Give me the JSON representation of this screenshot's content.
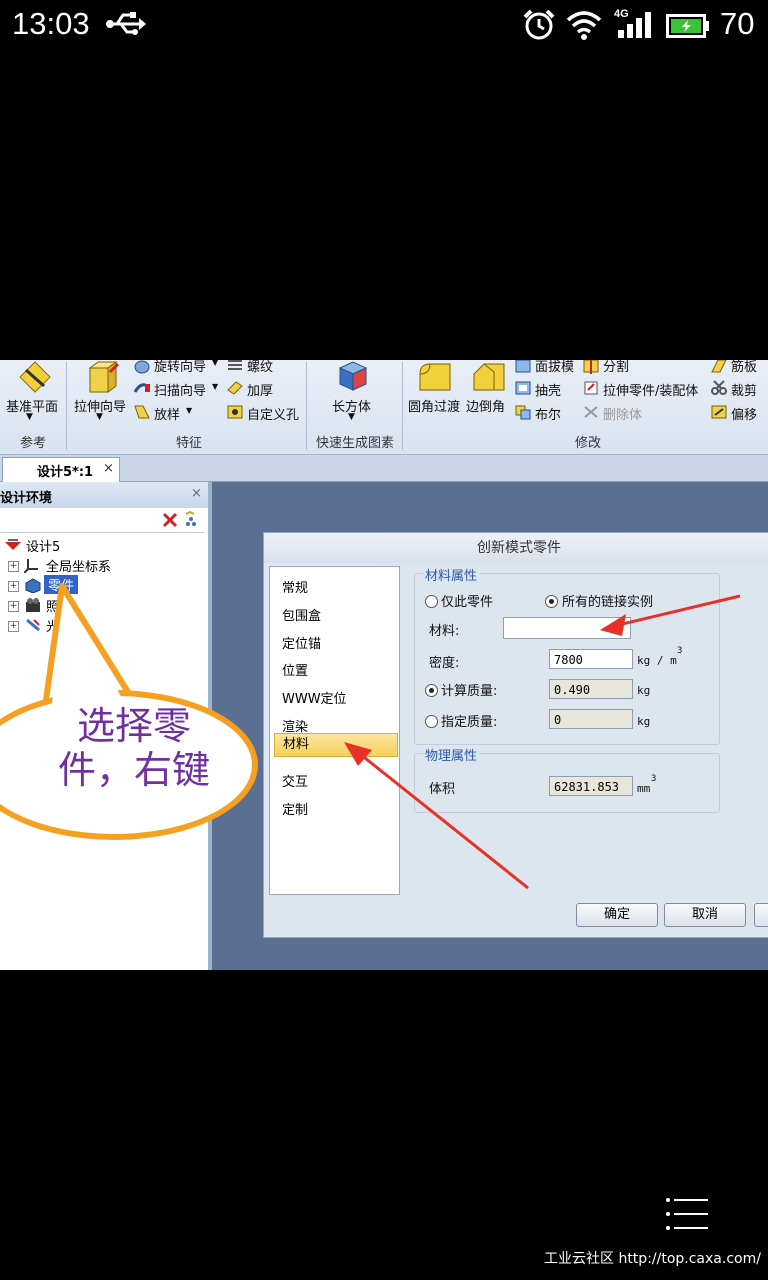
{
  "status_bar": {
    "time": "13:03",
    "battery_percent": "70",
    "network": "4G",
    "icons": [
      "usb-icon",
      "alarm-icon",
      "wifi-icon",
      "signal-icon",
      "battery-icon"
    ]
  },
  "ribbon": {
    "groups": [
      {
        "name": "参考",
        "items": [
          "基准平面"
        ]
      },
      {
        "name": "特征",
        "items": [
          "拉伸向导",
          "旋转向导",
          "扫描向导",
          "放样",
          "螺纹",
          "加厚",
          "自定义孔"
        ]
      },
      {
        "name": "快速生成图素",
        "items": [
          "长方体"
        ]
      },
      {
        "name": "修改",
        "items": [
          "圆角过渡",
          "边倒角",
          "面拔模",
          "抽壳",
          "布尔",
          "分割",
          "拉伸零件/装配体",
          "删除体",
          "筋板",
          "裁剪",
          "偏移"
        ]
      }
    ]
  },
  "document_tab": {
    "label": "设计5*:1",
    "close": "×"
  },
  "left_panel": {
    "title": "设计环境",
    "close": "×",
    "tree": [
      {
        "label": "设计5"
      },
      {
        "label": "全局坐标系"
      },
      {
        "label": "零件"
      },
      {
        "label": "照"
      },
      {
        "label": "光"
      }
    ]
  },
  "annotation": {
    "text_line1": "选择零",
    "text_line2": "件，右键"
  },
  "dialog": {
    "title": "创新模式零件",
    "nav_items": [
      "常规",
      "包围盒",
      "定位锚",
      "位置",
      "WWW定位",
      "渲染",
      "材料",
      "交互",
      "定制"
    ],
    "selected_item": "材料",
    "material_section": {
      "legend": "材料属性",
      "radio_this_part": "仅此零件",
      "radio_all_links": "所有的链接实例",
      "material_label": "材料:",
      "material_value": "",
      "density_label": "密度:",
      "density_value": "7800",
      "density_unit": "kg / m",
      "unit_exponent": "3",
      "calc_mass_label": "计算质量:",
      "calc_mass_value": "0.490",
      "specified_mass_label": "指定质量:",
      "specified_mass_value": "0",
      "mass_unit": "kg"
    },
    "physical_section": {
      "legend": "物理属性",
      "volume_label": "体积",
      "volume_value": "62831.853",
      "volume_unit": "mm",
      "volume_exponent": "3"
    },
    "buttons": {
      "ok": "确定",
      "cancel": "取消"
    }
  },
  "watermark": "工业云社区 http://top.caxa.com/",
  "colors": {
    "annotation_orange": "#f5a020",
    "annotation_purple": "#7030a0",
    "arrow_red": "#e8302a",
    "selection_yellow": "#f7cf5a"
  }
}
